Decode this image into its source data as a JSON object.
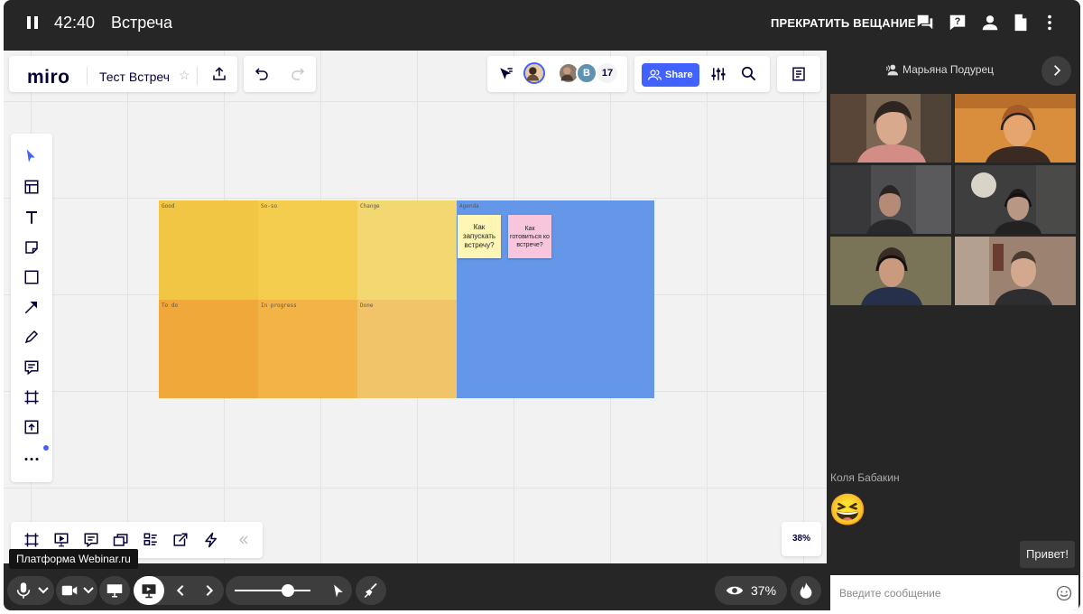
{
  "topbar": {
    "timer": "42:40",
    "title": "Встреча",
    "stop_broadcast": "ПРЕКРАТИТЬ ВЕЩАНИЕ",
    "icons": [
      "chat-icon",
      "question-icon",
      "user-icon",
      "document-icon",
      "more-vert-icon"
    ]
  },
  "miro": {
    "logo": "miro",
    "board_name": "Тест Встреч",
    "participant_avatar_letter": "B",
    "participant_count": "17",
    "share_label": "Share",
    "zoom": "38%"
  },
  "kanban": {
    "cells": [
      "Good",
      "So-so",
      "Change",
      "To do",
      "In progress",
      "Done",
      "Agenda"
    ],
    "stickies": [
      "Как запускать встречу?",
      "Как готовиться ко встрече?"
    ],
    "colors": {
      "good": "#f1c644",
      "soso": "#f4cd4e",
      "change": "#f3d872",
      "todo": "#f0a83a",
      "inprogress": "#f2b446",
      "done": "#f2c46a",
      "agenda": "#6597e8",
      "sticky_yellow": "#fff6b6",
      "sticky_pink": "#f7c6dc"
    }
  },
  "tooltip": "Платформа Webinar.ru",
  "presenter": {
    "name": "Марьяна Подурец"
  },
  "chat": {
    "author": "Коля Бабакин",
    "emoji": "😆",
    "bubble": "Привет!",
    "input_placeholder": "Введите сообщение"
  },
  "bottombar": {
    "viewers_pct": "37%"
  },
  "colors": {
    "app_bg": "#262626",
    "miro_accent": "#4262ff",
    "button_bg": "#3d3d3d"
  }
}
